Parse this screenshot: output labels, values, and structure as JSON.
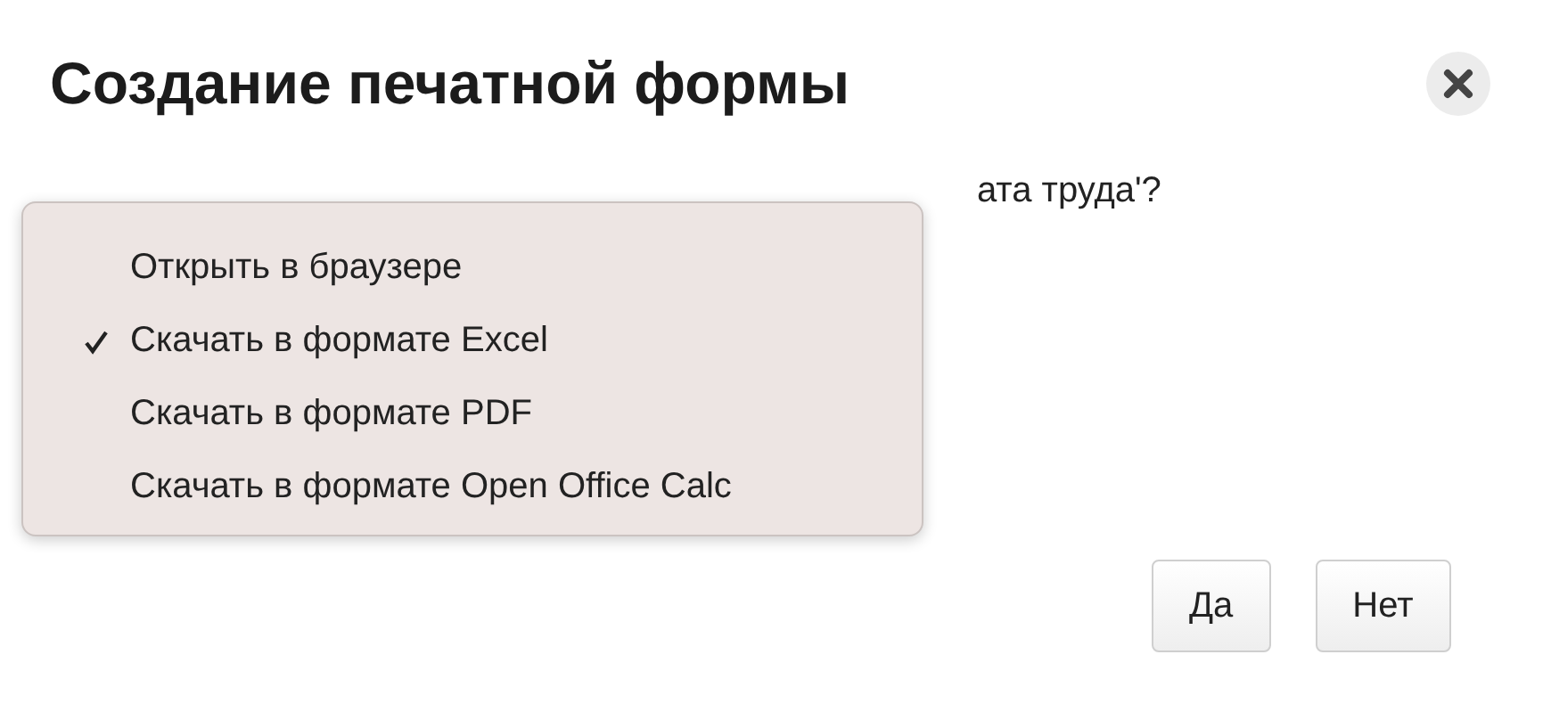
{
  "dialog": {
    "title": "Создание печатной формы",
    "question": "ата труда'?",
    "buttons": [
      {
        "label": "Да"
      },
      {
        "label": "Нет"
      }
    ]
  },
  "menu": {
    "items": [
      {
        "label": "Открыть в браузере",
        "checked": false
      },
      {
        "label": "Скачать в формате Excel",
        "checked": true
      },
      {
        "label": "Скачать в формате PDF",
        "checked": false
      },
      {
        "label": "Скачать в формате Open Office Calc",
        "checked": false
      }
    ]
  }
}
